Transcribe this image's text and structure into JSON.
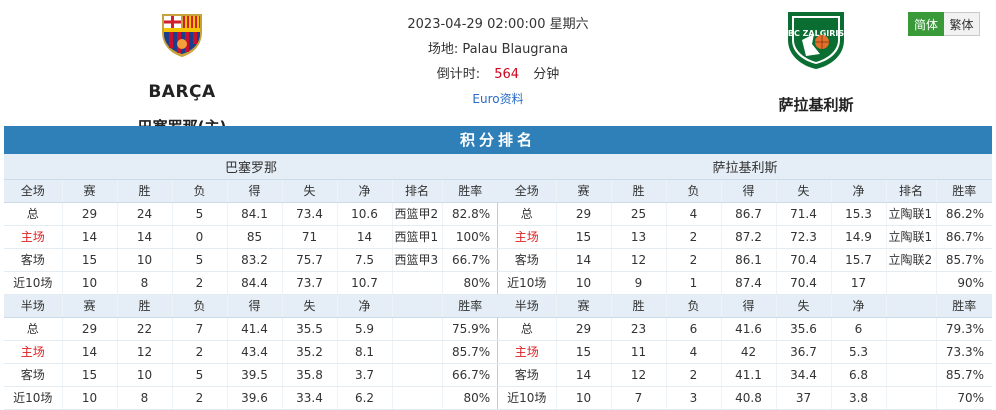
{
  "home": {
    "name": "巴塞罗那(主)",
    "logo_text": "BARÇA",
    "logo_icon": "fcb-crest"
  },
  "away": {
    "name": "萨拉基利斯",
    "logo_icon": "zalgiris-crest",
    "logo_text": "BC ZALGIRIS"
  },
  "match": {
    "datetime": "2023-04-29 02:00:00 星期六",
    "venue": "场地: Palau Blaugrana",
    "countdown_label": "倒计时:",
    "countdown_value": "564",
    "countdown_unit": "分钟",
    "link": "Euro资料"
  },
  "lang": {
    "simplified": "简体",
    "traditional": "繁体"
  },
  "standings": {
    "title": "积分排名",
    "left_team": "巴塞罗那",
    "right_team": "萨拉基利斯",
    "full_headers": [
      "全场",
      "赛",
      "胜",
      "负",
      "得",
      "失",
      "净",
      "排名",
      "胜率"
    ],
    "half_headers": [
      "半场",
      "赛",
      "胜",
      "负",
      "得",
      "失",
      "净",
      "",
      "胜率"
    ],
    "left_full": [
      [
        "总",
        "29",
        "24",
        "5",
        "84.1",
        "73.4",
        "10.6",
        "西篮甲2",
        "82.8%"
      ],
      [
        "主场",
        "14",
        "14",
        "0",
        "85",
        "71",
        "14",
        "西篮甲1",
        "100%"
      ],
      [
        "客场",
        "15",
        "10",
        "5",
        "83.2",
        "75.7",
        "7.5",
        "西篮甲3",
        "66.7%"
      ],
      [
        "近10场",
        "10",
        "8",
        "2",
        "84.4",
        "73.7",
        "10.7",
        "",
        "80%"
      ]
    ],
    "right_full": [
      [
        "总",
        "29",
        "25",
        "4",
        "86.7",
        "71.4",
        "15.3",
        "立陶联1",
        "86.2%"
      ],
      [
        "主场",
        "15",
        "13",
        "2",
        "87.2",
        "72.3",
        "14.9",
        "立陶联1",
        "86.7%"
      ],
      [
        "客场",
        "14",
        "12",
        "2",
        "86.1",
        "70.4",
        "15.7",
        "立陶联2",
        "85.7%"
      ],
      [
        "近10场",
        "10",
        "9",
        "1",
        "87.4",
        "70.4",
        "17",
        "",
        "90%"
      ]
    ],
    "left_half": [
      [
        "总",
        "29",
        "22",
        "7",
        "41.4",
        "35.5",
        "5.9",
        "",
        "75.9%"
      ],
      [
        "主场",
        "14",
        "12",
        "2",
        "43.4",
        "35.2",
        "8.1",
        "",
        "85.7%"
      ],
      [
        "客场",
        "15",
        "10",
        "5",
        "39.5",
        "35.8",
        "3.7",
        "",
        "66.7%"
      ],
      [
        "近10场",
        "10",
        "8",
        "2",
        "39.6",
        "33.4",
        "6.2",
        "",
        "80%"
      ]
    ],
    "right_half": [
      [
        "总",
        "29",
        "23",
        "6",
        "41.6",
        "35.6",
        "6",
        "",
        "79.3%"
      ],
      [
        "主场",
        "15",
        "11",
        "4",
        "42",
        "36.7",
        "5.3",
        "",
        "73.3%"
      ],
      [
        "客场",
        "14",
        "12",
        "2",
        "41.1",
        "34.4",
        "6.8",
        "",
        "85.7%"
      ],
      [
        "近10场",
        "10",
        "7",
        "3",
        "40.8",
        "37",
        "3.8",
        "",
        "70%"
      ]
    ]
  }
}
